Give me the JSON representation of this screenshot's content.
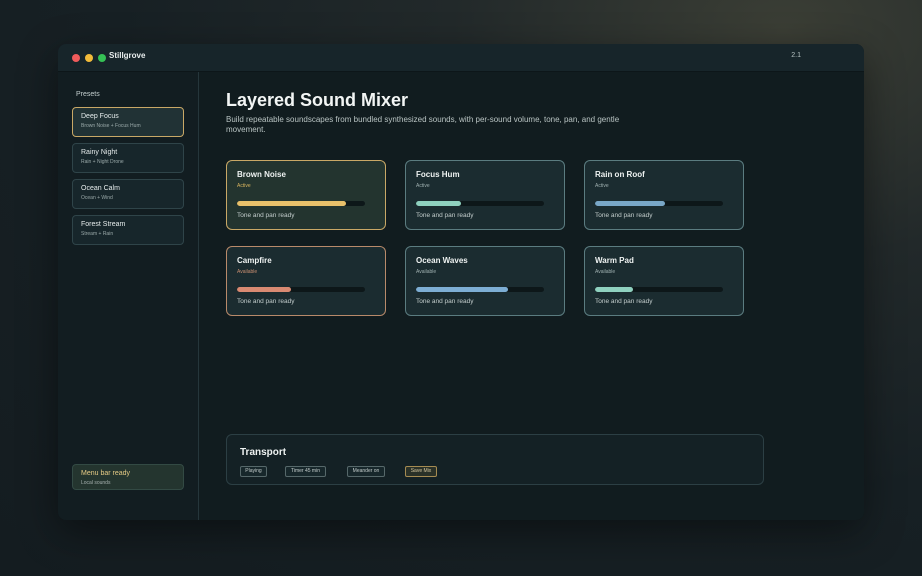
{
  "window": {
    "app_name": "Stillgrove",
    "version": "2.1"
  },
  "sidebar": {
    "heading": "Presets",
    "presets": [
      {
        "name": "Deep Focus",
        "sub": "Brown Noise + Focus Hum",
        "active": true
      },
      {
        "name": "Rainy Night",
        "sub": "Rain + Night Drone",
        "active": false
      },
      {
        "name": "Ocean Calm",
        "sub": "Ocean + Wind",
        "active": false
      },
      {
        "name": "Forest Stream",
        "sub": "Stream + Rain",
        "active": false
      }
    ],
    "status": {
      "title": "Menu bar ready",
      "sub": "Local sounds"
    }
  },
  "main": {
    "title": "Layered Sound Mixer",
    "description": "Build repeatable soundscapes from bundled synthesized sounds, with per-sound volume, tone, pan, and gentle movement."
  },
  "sounds": [
    {
      "name": "Brown Noise",
      "status": "Active",
      "level": 0.85,
      "color": "#e8c06a",
      "footer": "Tone and pan ready"
    },
    {
      "name": "Focus Hum",
      "status": "Active",
      "level": 0.35,
      "color": "#8fd1bf",
      "footer": "Tone and pan ready"
    },
    {
      "name": "Rain on Roof",
      "status": "Active",
      "level": 0.55,
      "color": "#79a7c7",
      "footer": "Tone and pan ready"
    },
    {
      "name": "Campfire",
      "status": "Available",
      "level": 0.42,
      "color": "#d98a72",
      "footer": "Tone and pan ready"
    },
    {
      "name": "Ocean Waves",
      "status": "Available",
      "level": 0.72,
      "color": "#7daed4",
      "footer": "Tone and pan ready"
    },
    {
      "name": "Warm Pad",
      "status": "Available",
      "level": 0.3,
      "color": "#8fd1bf",
      "footer": "Tone and pan ready"
    }
  ],
  "transport": {
    "title": "Transport",
    "buttons": [
      "Playing",
      "Timer 45 min",
      "Meander on",
      "Save Mix"
    ]
  },
  "colors": {
    "accent_gold": "#c9a866",
    "card_border": "#5b7c80",
    "background": "#111c1f"
  }
}
